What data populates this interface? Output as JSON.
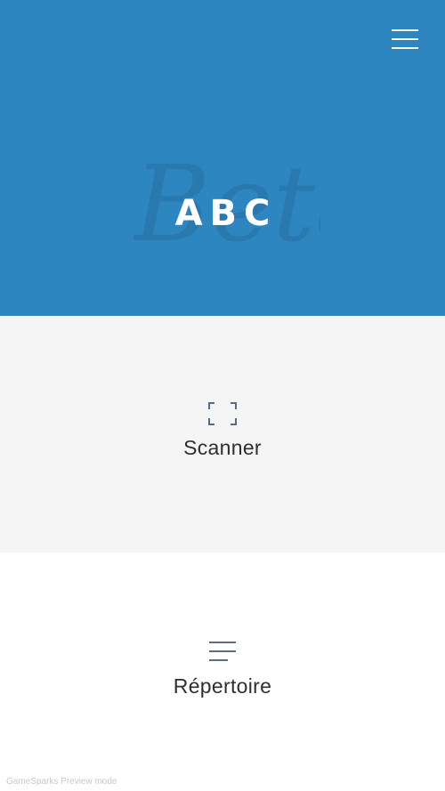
{
  "header": {
    "logo_text": "ABC",
    "watermark_text": "Beta",
    "menu_icon": "hamburger-menu-icon",
    "background_color": "#2e86c1"
  },
  "sections": {
    "scanner": {
      "label": "Scanner",
      "icon": "scan-frame-icon",
      "background_color": "#f5f5f5"
    },
    "repertoire": {
      "label": "Répertoire",
      "icon": "list-lines-icon",
      "background_color": "#ffffff"
    }
  },
  "footer": {
    "preview_note": "GameSparks Preview mode"
  },
  "colors": {
    "icon_color": "#5a6b82",
    "label_color": "#2f2f2f"
  }
}
